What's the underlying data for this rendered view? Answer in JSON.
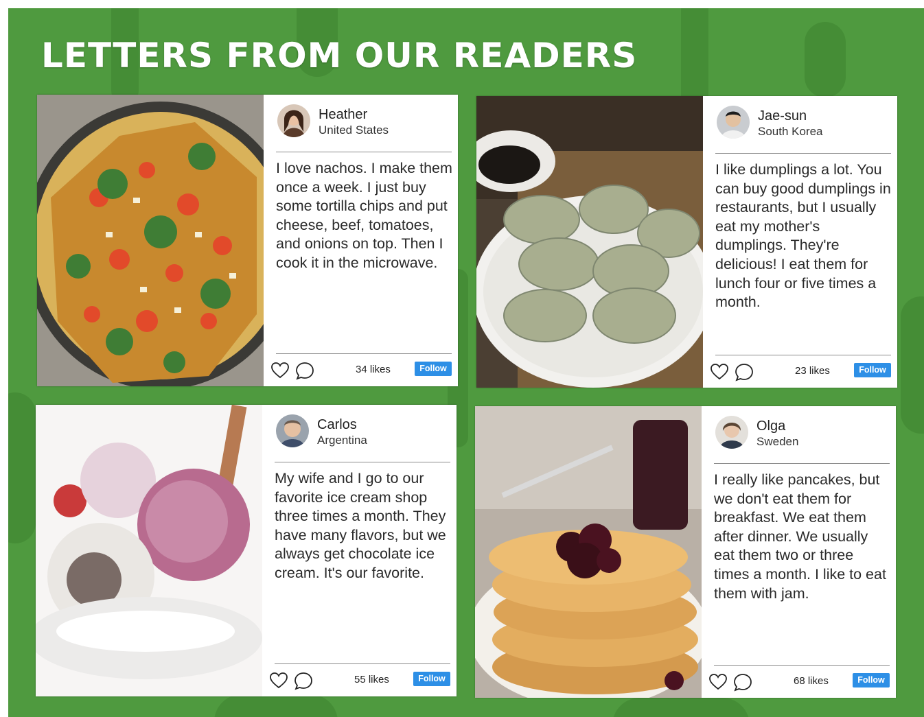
{
  "page_title": "LETTERS FROM OUR READERS",
  "icons": {
    "like": "heart-icon",
    "comment": "speech-bubble-icon"
  },
  "colors": {
    "background": "#4f9a3f",
    "follow": "#2d8fe6"
  },
  "posts": [
    {
      "name": "Heather",
      "country": "United States",
      "photo": "nachos",
      "text": "I love nachos. I make them once a week. I just buy some tortilla chips and put cheese, beef, tomatoes, and onions on top. Then I cook it in the microwave.",
      "likes": "34 likes",
      "follow_label": "Follow"
    },
    {
      "name": "Jae-sun",
      "country": "South Korea",
      "photo": "dumplings",
      "text": "I like dumplings a lot. You can buy good dumplings in restaurants, but I usually eat my mother's dumplings. They're delicious! I eat them for lunch four or five times a month.",
      "likes": "23 likes",
      "follow_label": "Follow"
    },
    {
      "name": "Carlos",
      "country": "Argentina",
      "photo": "ice cream",
      "text": "My wife and I go to our favorite ice cream shop three times a month. They have many flavors, but we always get chocolate ice cream. It's our favorite.",
      "likes": "55 likes",
      "follow_label": "Follow"
    },
    {
      "name": "Olga",
      "country": "Sweden",
      "photo": "pancakes",
      "text": "I really like pancakes, but we don't eat them for breakfast. We eat them after dinner. We usually eat them two or three times a month. I like to eat them with jam.",
      "likes": "68 likes",
      "follow_label": "Follow"
    }
  ]
}
